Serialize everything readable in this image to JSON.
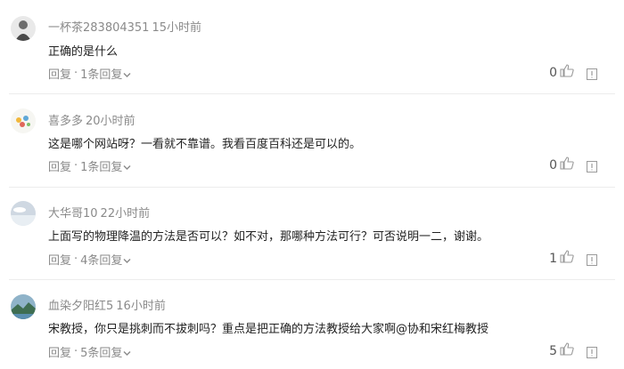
{
  "comments": [
    {
      "username": "一杯茶283804351",
      "time": "15小时前",
      "text": "正确的是什么",
      "reply_label": "回复",
      "replies_label": "1条回复",
      "likes": "0",
      "avatar": "avatar-gray-figure"
    },
    {
      "username": "喜多多",
      "time": "20小时前",
      "text": "这是哪个网站呀？一看就不靠谱。我看百度百科还是可以的。",
      "reply_label": "回复",
      "replies_label": "1条回复",
      "likes": "0",
      "avatar": "avatar-cartoon"
    },
    {
      "username": "大华哥10",
      "time": "22小时前",
      "text": "上面写的物理降温的方法是否可以？如不对，那哪种方法可行？可否说明一二，谢谢。",
      "reply_label": "回复",
      "replies_label": "4条回复",
      "likes": "1",
      "avatar": "avatar-sky"
    },
    {
      "username": "血染夕阳红5",
      "time": "16小时前",
      "text": "宋教授，你只是挑刺而不拔刺吗？重点是把正确的方法教授给大家啊@协和宋红梅教授",
      "reply_label": "回复",
      "replies_label": "5条回复",
      "likes": "5",
      "avatar": "avatar-landscape"
    }
  ],
  "separator_dot": "·",
  "colors": {
    "meta": "#8a8a8a",
    "text": "#222222",
    "separator": "#ececec"
  }
}
